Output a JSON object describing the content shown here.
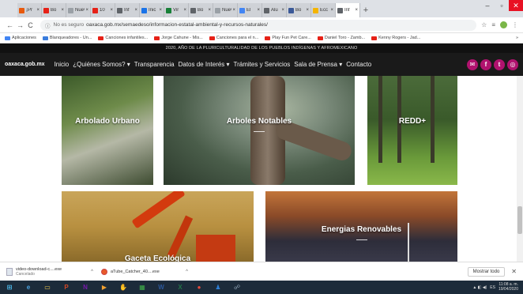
{
  "browser": {
    "tabs": [
      {
        "label": "¡Pr",
        "color": "#e8590c"
      },
      {
        "label": "Bo",
        "color": "#e62117"
      },
      {
        "label": "Nuev",
        "color": "#9aa0a6"
      },
      {
        "label": "10",
        "color": "#e62117"
      },
      {
        "label": "Inf",
        "color": "#5f6368"
      },
      {
        "label": "Inic",
        "color": "#1a73e8"
      },
      {
        "label": "Vir",
        "color": "#188038"
      },
      {
        "label": "Bo",
        "color": "#5f6368"
      },
      {
        "label": "Nuev",
        "color": "#9aa0a6"
      },
      {
        "label": "El",
        "color": "#4285f4"
      },
      {
        "label": "Alu",
        "color": "#5f6368"
      },
      {
        "label": "Bo",
        "color": "#3b5998"
      },
      {
        "label": "Ecc",
        "color": "#f4b400"
      },
      {
        "label": "Inf",
        "color": "#5f6368",
        "active": true
      }
    ],
    "new_tab": "+",
    "window": {
      "minimize": "–",
      "maximize": "▫",
      "close": "✕"
    },
    "nav": {
      "back": "←",
      "forward": "→",
      "reload": "C"
    },
    "address": {
      "security_icon": "ⓘ",
      "security_text": "No es seguro",
      "url": "oaxaca.gob.mx/semaedeso/informacion-estatal-ambiental-y-recursos-naturales/"
    },
    "toolbar_icons": {
      "star": "☆",
      "reader": "≡",
      "menu": "⋮"
    },
    "bookmarks": [
      {
        "label": "Aplicaciones",
        "icon": "grid"
      },
      {
        "label": "Blanqueadores - Un...",
        "icon": "blue"
      },
      {
        "label": "Canciones infantiles...",
        "icon": "yt"
      },
      {
        "label": "Jorge Cahune - Mis...",
        "icon": "yt"
      },
      {
        "label": "Canciones para el n...",
        "icon": "yt"
      },
      {
        "label": "Play Fun Pet Care...",
        "icon": "yt"
      },
      {
        "label": "Daniel Toro - Zamb...",
        "icon": "yt"
      },
      {
        "label": "Kenny Rogers - Jad...",
        "icon": "yt"
      }
    ],
    "bookmarks_more": "»"
  },
  "site": {
    "banner": "2020, AÑO DE LA PLURICULTURALIDAD DE LOS PUEBLOS INDÍGENAS Y AFROMEXICANO",
    "logo": "oaxaca.gob.mx",
    "menu": [
      "Inicio",
      "¿Quiénes Somos? ▾",
      "Transparencia",
      "Datos de Interés ▾",
      "Trámites y Servicios",
      "Sala de Prensa ▾",
      "Contacto"
    ],
    "social": [
      "✉",
      "f",
      "t",
      "◎"
    ],
    "cards": [
      {
        "title": "Arbolado Urbano"
      },
      {
        "title": "Arboles Notables"
      },
      {
        "title": "REDD+"
      },
      {
        "title": "Gaceta Ecológica"
      },
      {
        "title": "Energias Renovables"
      }
    ]
  },
  "downloads": {
    "items": [
      {
        "name": "video-download-c....exe",
        "status": "Cancelado"
      },
      {
        "name": "aTube_Catcher_40....exe",
        "status": ""
      }
    ],
    "show_all": "Mostrar todo",
    "close": "✕"
  },
  "taskbar": {
    "apps": [
      {
        "name": "start",
        "glyph": "⊞",
        "color": "#4fc3f7"
      },
      {
        "name": "ie",
        "glyph": "e",
        "color": "#4aa3e0"
      },
      {
        "name": "explorer",
        "glyph": "▭",
        "color": "#f2c94c"
      },
      {
        "name": "powerpoint",
        "glyph": "P",
        "color": "#d24726"
      },
      {
        "name": "onenote",
        "glyph": "N",
        "color": "#7719aa"
      },
      {
        "name": "media",
        "glyph": "▶",
        "color": "#f0a030"
      },
      {
        "name": "hand",
        "glyph": "✋",
        "color": "#f7c88a"
      },
      {
        "name": "calculator",
        "glyph": "▦",
        "color": "#3fae49"
      },
      {
        "name": "word",
        "glyph": "W",
        "color": "#2b579a"
      },
      {
        "name": "excel",
        "glyph": "X",
        "color": "#217346"
      },
      {
        "name": "chrome",
        "glyph": "●",
        "color": "#e84b3c"
      },
      {
        "name": "people",
        "glyph": "♟",
        "color": "#2d7dd2"
      },
      {
        "name": "network",
        "glyph": "☍",
        "color": "#8fa3b5"
      }
    ],
    "tray": {
      "icons": "▲ ◧ ◀)",
      "lang": "ES",
      "time": "11:08 a. m.",
      "date": "19/04/2020"
    }
  }
}
